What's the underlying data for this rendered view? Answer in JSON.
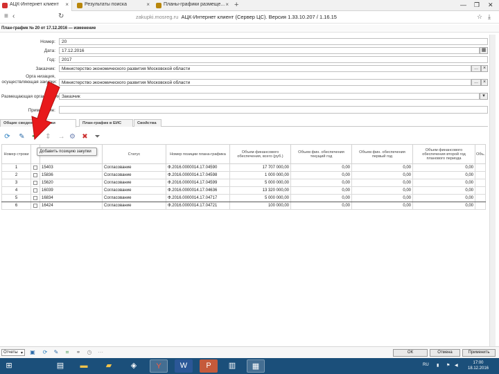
{
  "browser": {
    "tabs": [
      {
        "label": "АЦК-Интернет клиент",
        "active": true,
        "favicon_color": "#d32f2f"
      },
      {
        "label": "Результаты поиска",
        "active": false,
        "favicon_color": "#b8860b"
      },
      {
        "label": "Планы-графики размеще...",
        "active": false,
        "favicon_color": "#b8860b"
      }
    ],
    "close_glyph": "×",
    "new_tab_glyph": "+",
    "url_host": "zakupki.mosreg.ru",
    "url_title": "АЦК-Интернет клиент (Сервер ЦС). Версия 1.33.10.207 / 1.16.15",
    "window_controls": [
      "—",
      "❐",
      "✕"
    ]
  },
  "page": {
    "title": "План-график № 20 от 17.12.2016 — изменение"
  },
  "form": {
    "number_label": "Номер:",
    "number_value": "20",
    "date_label": "Дата:",
    "date_value": "17.12.2016",
    "year_label": "Год:",
    "year_value": "2017",
    "customer_label": "Заказчик:",
    "customer_value": "Министерство экономического развития Московской области",
    "org_label_1": "Орга низация,",
    "org_label_2": "осуществляющая закупки:",
    "org_value": "Министерство экономического развития Московской области",
    "placer_label": "Размещающая организация:",
    "placer_value": "Заказчик",
    "notes_label": "Примечание:",
    "notes_value": "",
    "ellipsis": "...",
    "clear_glyph": "×",
    "calendar_glyph": "▦",
    "dropdown_glyph": "▾"
  },
  "inner_tabs": [
    {
      "label": "Общие сведения",
      "active": false
    },
    {
      "label": "Закупки",
      "active": true
    },
    {
      "label": "План-график в ЕИС",
      "active": false
    },
    {
      "label": "Свойства",
      "active": false
    }
  ],
  "toolbar": {
    "tooltip": "Добавить позицию закупки"
  },
  "table": {
    "headers": [
      "Номер строки",
      "",
      "Номер",
      "Статус",
      "Номер позиции плана-графика",
      "Объем финансового обеспечения, всего (руб.)",
      "Объем фин. обеспечения текущий год",
      "Объем фин. обеспечения первый год",
      "Объем финансового обеспечения второй год планового периода",
      "Объ..."
    ],
    "rows": [
      {
        "n": "1",
        "num": "15403",
        "status": "Согласование",
        "pos": "Ф.2016.0000014.17.04590",
        "total": "17 707 000,00",
        "y0": "0,00",
        "y1": "0,00",
        "y2": "0,00",
        "selected": false
      },
      {
        "n": "2",
        "num": "15836",
        "status": "Согласование",
        "pos": "Ф.2016.0000014.17.04598",
        "total": "1 000 000,00",
        "y0": "0,00",
        "y1": "0,00",
        "y2": "0,00",
        "selected": false
      },
      {
        "n": "3",
        "num": "15620",
        "status": "Согласование",
        "pos": "Ф.2016.0000014.17.04599",
        "total": "5 000 000,00",
        "y0": "0,00",
        "y1": "0,00",
        "y2": "0,00",
        "selected": false
      },
      {
        "n": "4",
        "num": "16039",
        "status": "Согласование",
        "pos": "Ф.2016.0000014.17.04636",
        "total": "13 320 000,00",
        "y0": "0,00",
        "y1": "0,00",
        "y2": "0,00",
        "selected": false
      },
      {
        "n": "5",
        "num": "16834",
        "status": "Согласование",
        "pos": "Ф.2016.0000014.17.04717",
        "total": "5 000 000,00",
        "y0": "0,00",
        "y1": "0,00",
        "y2": "0,00",
        "selected": true
      },
      {
        "n": "6",
        "num": "16424",
        "status": "Согласование",
        "pos": "Ф.2016.0000014.17.04721",
        "total": "100 000,00",
        "y0": "0,00",
        "y1": "0,00",
        "y2": "0,00",
        "selected": false
      }
    ]
  },
  "footer": {
    "select_value": "Отчеты",
    "dropdown_glyph": "▾",
    "ok_label": "ОК",
    "cancel_label": "Отмена",
    "apply_label": "Применить"
  },
  "taskbar": {
    "tray_lang": "RU",
    "time": "17:00",
    "date": "18.12.2016"
  },
  "colors": {
    "arrow": "#e8191b",
    "taskbar": "#1b4f7a"
  }
}
